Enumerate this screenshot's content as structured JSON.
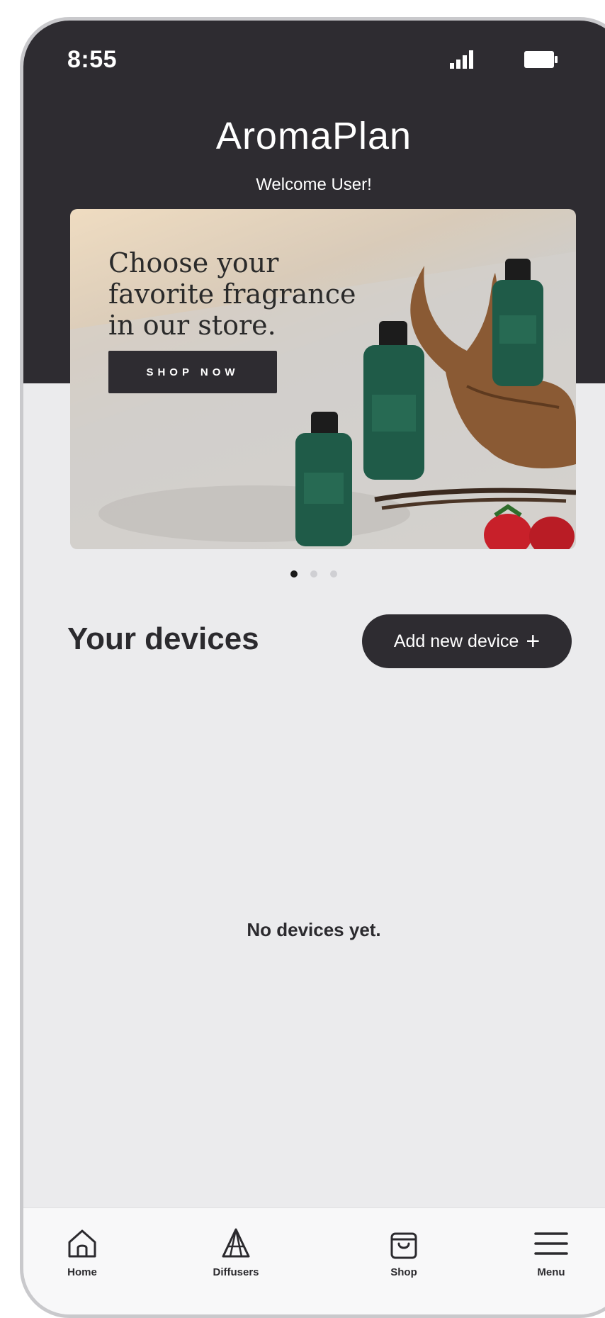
{
  "status_bar": {
    "time": "8:55"
  },
  "header": {
    "app_title": "AromaPlan",
    "welcome": "Welcome User!"
  },
  "banner": {
    "headline_line1": "Choose your",
    "headline_line2": "favorite fragrance",
    "headline_line3": "in our store.",
    "cta_label": "SHOP NOW",
    "slide_count": 3,
    "active_slide": 1
  },
  "devices": {
    "section_title": "Your devices",
    "add_button_label": "Add new device",
    "add_button_icon": "plus-icon",
    "empty_message": "No devices yet."
  },
  "bottom_nav": {
    "items": [
      {
        "label": "Home",
        "icon": "home-icon"
      },
      {
        "label": "Diffusers",
        "icon": "diffuser-icon"
      },
      {
        "label": "Shop",
        "icon": "shopping-bag-icon"
      },
      {
        "label": "Menu",
        "icon": "hamburger-menu-icon"
      }
    ]
  },
  "colors": {
    "header_dark": "#2e2c31",
    "background": "#ebebed",
    "bottle_green": "#1f5b48"
  }
}
